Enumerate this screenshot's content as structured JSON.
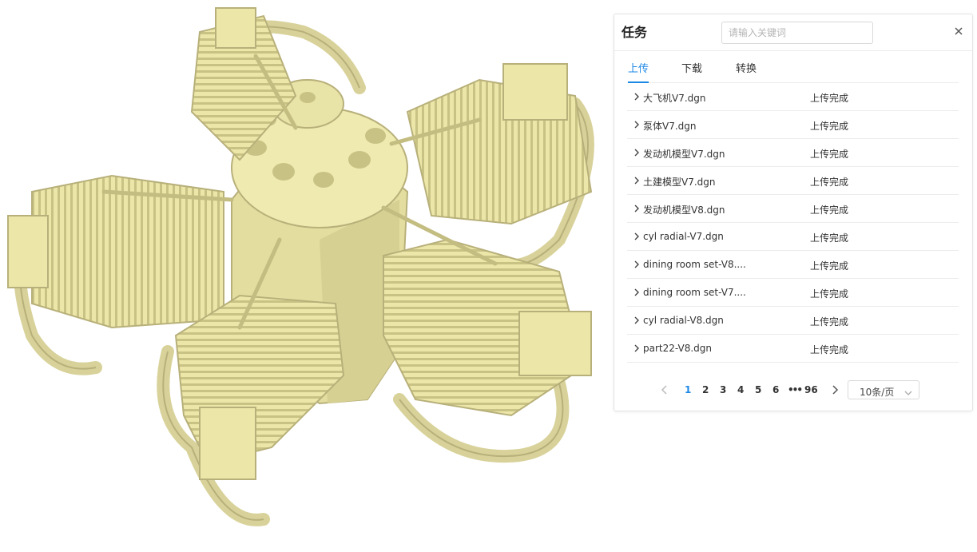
{
  "viewer": {
    "model_icon": "radial-engine-model",
    "model_color": "#ece7a9"
  },
  "panel": {
    "title": "任务",
    "search_placeholder": "请输入关键词",
    "close_icon": "close-icon",
    "tabs": [
      {
        "label": "上传",
        "active": true
      },
      {
        "label": "下载",
        "active": false
      },
      {
        "label": "转换",
        "active": false
      }
    ],
    "rows": [
      {
        "name": "大飞机V7.dgn",
        "status": "上传完成"
      },
      {
        "name": "泵体V7.dgn",
        "status": "上传完成"
      },
      {
        "name": "发动机模型V7.dgn",
        "status": "上传完成"
      },
      {
        "name": "土建模型V7.dgn",
        "status": "上传完成"
      },
      {
        "name": "发动机模型V8.dgn",
        "status": "上传完成"
      },
      {
        "name": "cyl radial-V7.dgn",
        "status": "上传完成"
      },
      {
        "name": "dining room set-V8....",
        "status": "上传完成"
      },
      {
        "name": "dining room set-V7....",
        "status": "上传完成"
      },
      {
        "name": "cyl radial-V8.dgn",
        "status": "上传完成"
      },
      {
        "name": "part22-V8.dgn",
        "status": "上传完成"
      }
    ],
    "pagination": {
      "pages": [
        "1",
        "2",
        "3",
        "4",
        "5",
        "6",
        "•••",
        "96"
      ],
      "current": "1",
      "page_size": "10条/页"
    },
    "accent_color": "#1e88e5"
  }
}
